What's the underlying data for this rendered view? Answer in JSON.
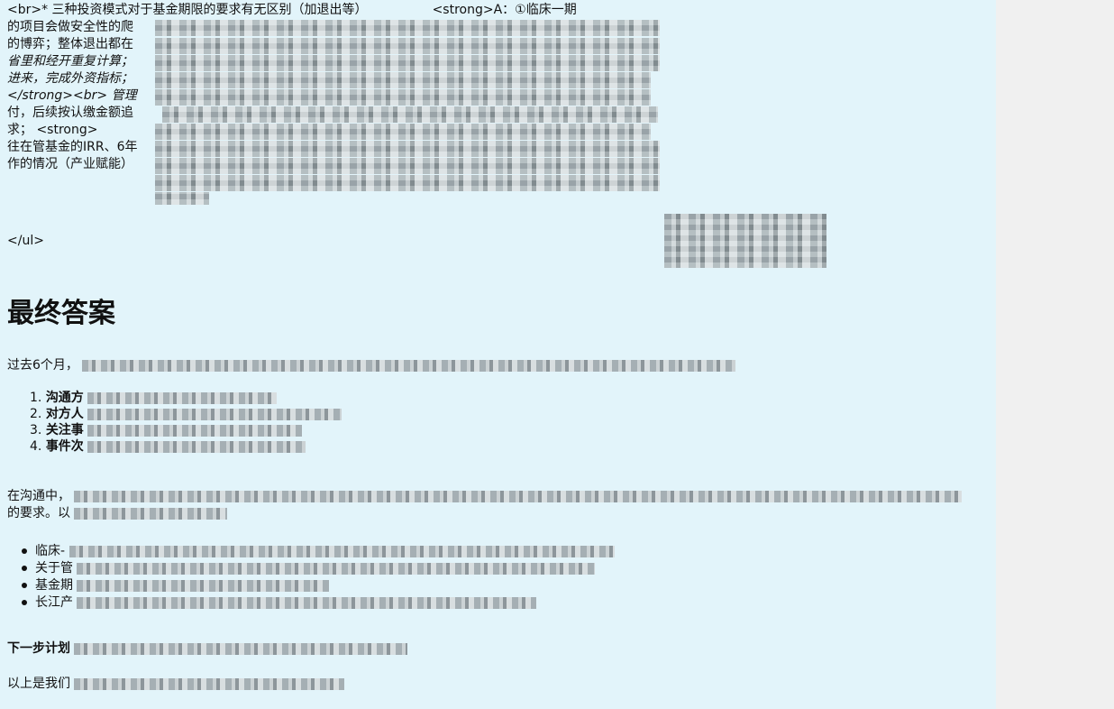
{
  "top_lines": [
    {
      "text": "<br>* 三种投资模式对于基金期限的要求有无区别（加退出等）",
      "extra": "<strong>A：①临床一期",
      "italic": false
    },
    {
      "text": "的项目会做安全性的爬",
      "italic": false
    },
    {
      "text": "的博弈；整体退出都在",
      "italic": false
    },
    {
      "text": "省里和经开重复计算；",
      "italic": true
    },
    {
      "text": "进来，完成外资指标；",
      "italic": true
    },
    {
      "text": "</strong><br> 管理",
      "italic": false,
      "mixed": true
    },
    {
      "text": "付，后续按认缴金额追",
      "italic": false
    },
    {
      "text": "求；  <strong>",
      "italic": false
    },
    {
      "text": "往在管基金的IRR、6年",
      "italic": false
    },
    {
      "text": "作的情况（产业赋能）",
      "italic": false
    }
  ],
  "ul_close": "</ul>",
  "heading": "最终答案",
  "intro": "过去6个月，",
  "ordered_items": [
    {
      "num": "1.",
      "label": "沟通方"
    },
    {
      "num": "2.",
      "label": "对方人"
    },
    {
      "num": "3.",
      "label": "关注事"
    },
    {
      "num": "4.",
      "label": "事件次"
    }
  ],
  "comm_line1": "在沟通中，",
  "comm_line2": "的要求。以",
  "bullets": [
    {
      "label": "临床-"
    },
    {
      "label": "关于管"
    },
    {
      "label": "基金期"
    },
    {
      "label": "长江产"
    }
  ],
  "next_plan_label": "下一步计划",
  "closing": "以上是我们"
}
